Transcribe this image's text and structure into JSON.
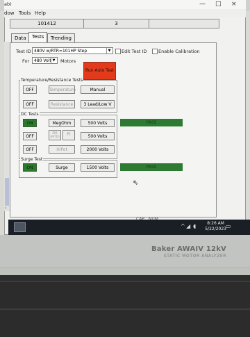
{
  "window": {
    "partial_title": "ab)",
    "controls": [
      "—",
      "□",
      "×"
    ]
  },
  "menubar": {
    "items": [
      "dow",
      "Tools",
      "Help"
    ]
  },
  "info_bar": {
    "left_value": "101412",
    "center_value": "3"
  },
  "tabs": [
    {
      "label": "Data",
      "active": false
    },
    {
      "label": "Tests",
      "active": true
    },
    {
      "label": "Trending",
      "active": false
    }
  ],
  "test_header": {
    "test_id_label": "Test ID",
    "test_id_value": "480V w/RTR=101HP Step",
    "edit_test_id_label": "Edit Test ID",
    "enable_calibration_label": "Enable Calibration",
    "for_label": "For",
    "for_value": "480 Volt",
    "motors_label": "Motors",
    "run_auto_test": "Run Auto Test"
  },
  "temperature_section": {
    "title": "Temperature/Resistance Tests",
    "row1": {
      "state": "OFF",
      "name": "Temperature",
      "value": "Manual"
    },
    "row2": {
      "state": "OFF",
      "name": "Resistance",
      "value": "3 Lead/Low V"
    }
  },
  "dc_section": {
    "title": "DC Tests",
    "rows": [
      {
        "state": "ON",
        "name": "MegOhm",
        "value": "500 Volts",
        "result": "PASS"
      },
      {
        "state": "OFF",
        "name_a": "DA",
        "name_a2": "(MTD)",
        "name_b": "PI",
        "value": "500 Volts"
      },
      {
        "state": "OFF",
        "name": "HiPot",
        "value": "2000 Volts"
      }
    ]
  },
  "surge_section": {
    "title": "Surge Test",
    "row": {
      "state": "ON",
      "name": "Surge",
      "value": "1500 Volts",
      "result": "PASS"
    }
  },
  "status_bar": {
    "caps": "CAP",
    "num": "NUM"
  },
  "taskbar": {
    "time": "8:26 AM",
    "date": "5/22/2023"
  },
  "device": {
    "brand": "Baker AWAIV 12kV",
    "subtitle": "STATIC MOTOR ANALYZER"
  }
}
